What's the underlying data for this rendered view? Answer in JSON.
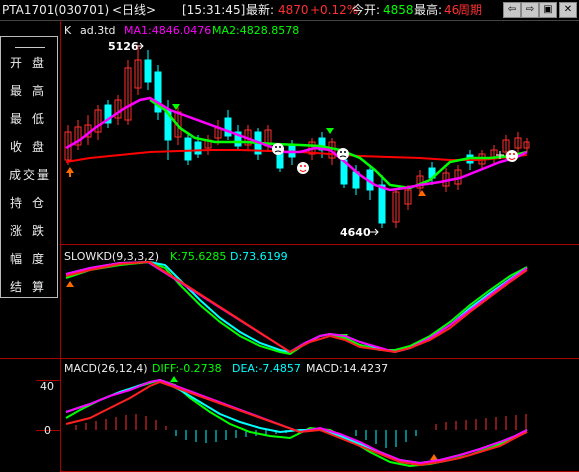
{
  "header": {
    "symbol": "PTA1701",
    "code": "(030701)",
    "period": "<日线>",
    "time": "[15:31:45]",
    "latest_label": "最新:",
    "latest_value": "4870",
    "change": "+0.12%",
    "open_label": "今开:",
    "open_value": "4858",
    "high_label": "最高:",
    "high_value": "46",
    "cycle_label": "周期",
    "btn_prev": "⇦",
    "btn_next": "⇨",
    "btn_restore": "▣",
    "btn_close": "✕"
  },
  "sidebar": {
    "items": [
      "开盘",
      "最高",
      "最低",
      "收盘",
      "成交量",
      "持仓",
      "涨跌",
      "幅度",
      "结算"
    ]
  },
  "main_panel": {
    "title": "K",
    "name": "ad.3td",
    "ma1": "MA1:4846.0476",
    "ma2": "MA2:4828.8578",
    "peak_label": "5126",
    "trough_label": "4640"
  },
  "kd_panel": {
    "title": "SLOWKD(9,3,3,2)",
    "k": "K:75.6285",
    "d": "D:73.6199"
  },
  "macd_panel": {
    "title": "MACD(26,12,4)",
    "diff": "DIFF:-0.2738",
    "dea": "DEA:-7.4857",
    "macd": "MACD:14.4237",
    "axis_40": "40",
    "axis_0": "0"
  },
  "colors": {
    "up": "#ff3030",
    "down": "#00ffff",
    "ma1": "#ff00ff",
    "ma2": "#00ff00",
    "ma3": "#ff0000",
    "kline": "#00ffff",
    "dline": "#ff00ff"
  }
}
